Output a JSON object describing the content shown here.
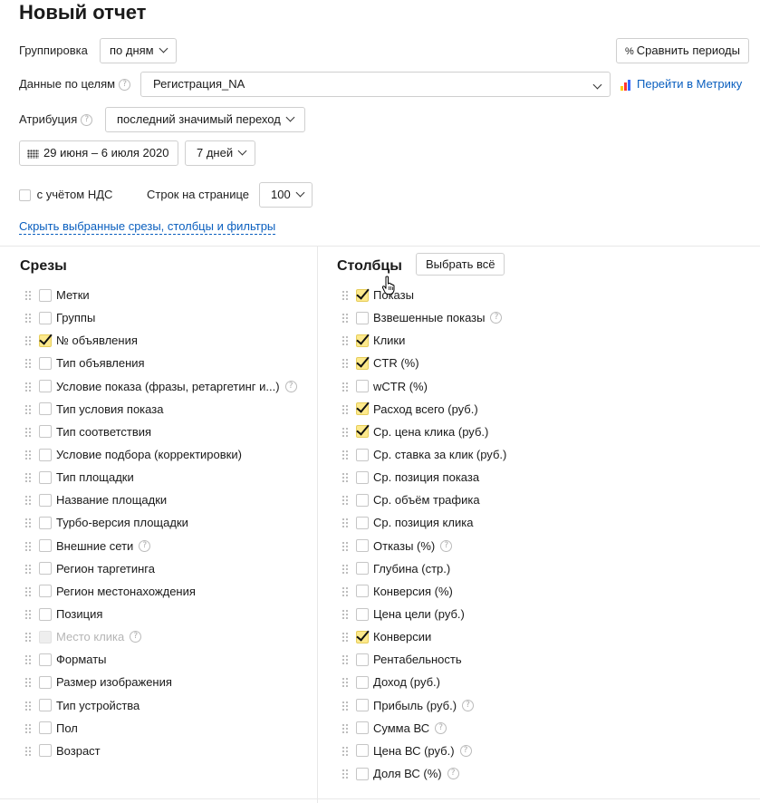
{
  "header": {
    "title": "Новый отчет"
  },
  "controls": {
    "grouping_label": "Группировка",
    "grouping_value": "по дням",
    "compare_label": "Сравнить периоды",
    "compare_icon": "%",
    "goals_label": "Данные по целям",
    "goals_value": "Регистрация_NA",
    "metrika_link": "Перейти в Метрику",
    "attribution_label": "Атрибуция",
    "attribution_value": "последний значимый переход",
    "date_range": "29 июня – 6 июля 2020",
    "period_value": "7 дней",
    "vat_label": "с учётом НДС",
    "rows_label": "Строк на странице",
    "rows_value": "100",
    "hide_link": "Скрыть выбранные срезы, столбцы и фильтры",
    "help_glyph": "?"
  },
  "slices": {
    "title": "Срезы",
    "items": [
      {
        "label": "Метки",
        "checked": false
      },
      {
        "label": "Группы",
        "checked": false
      },
      {
        "label": "№ объявления",
        "checked": true
      },
      {
        "label": "Тип объявления",
        "checked": false
      },
      {
        "label": "Условие показа (фразы, ретаргетинг и...)",
        "checked": false,
        "help": true
      },
      {
        "label": "Тип условия показа",
        "checked": false
      },
      {
        "label": "Тип соответствия",
        "checked": false
      },
      {
        "label": "Условие подбора (корректировки)",
        "checked": false
      },
      {
        "label": "Тип площадки",
        "checked": false
      },
      {
        "label": "Название площадки",
        "checked": false
      },
      {
        "label": "Турбо-версия площадки",
        "checked": false
      },
      {
        "label": "Внешние сети",
        "checked": false,
        "help": true
      },
      {
        "label": "Регион таргетинга",
        "checked": false
      },
      {
        "label": "Регион местонахождения",
        "checked": false
      },
      {
        "label": "Позиция",
        "checked": false
      },
      {
        "label": "Место клика",
        "checked": false,
        "disabled": true,
        "help": true
      },
      {
        "label": "Форматы",
        "checked": false
      },
      {
        "label": "Размер изображения",
        "checked": false
      },
      {
        "label": "Тип устройства",
        "checked": false
      },
      {
        "label": "Пол",
        "checked": false
      },
      {
        "label": "Возраст",
        "checked": false
      }
    ]
  },
  "columns": {
    "title": "Столбцы",
    "select_all": "Выбрать всё",
    "items": [
      {
        "label": "Показы",
        "checked": true
      },
      {
        "label": "Взвешенные показы",
        "checked": false,
        "help": true
      },
      {
        "label": "Клики",
        "checked": true
      },
      {
        "label": "CTR (%)",
        "checked": true
      },
      {
        "label": "wCTR (%)",
        "checked": false
      },
      {
        "label": "Расход всего (руб.)",
        "checked": true
      },
      {
        "label": "Ср. цена клика (руб.)",
        "checked": true
      },
      {
        "label": "Ср. ставка за клик (руб.)",
        "checked": false
      },
      {
        "label": "Ср. позиция показа",
        "checked": false
      },
      {
        "label": "Ср. объём трафика",
        "checked": false
      },
      {
        "label": "Ср. позиция клика",
        "checked": false
      },
      {
        "label": "Отказы (%)",
        "checked": false,
        "help": true
      },
      {
        "label": "Глубина (стр.)",
        "checked": false
      },
      {
        "label": "Конверсия (%)",
        "checked": false
      },
      {
        "label": "Цена цели (руб.)",
        "checked": false
      },
      {
        "label": "Конверсии",
        "checked": true
      },
      {
        "label": "Рентабельность",
        "checked": false
      },
      {
        "label": "Доход (руб.)",
        "checked": false
      },
      {
        "label": "Прибыль (руб.)",
        "checked": false,
        "help": true
      },
      {
        "label": "Сумма ВС",
        "checked": false,
        "help": true
      },
      {
        "label": "Цена ВС (руб.)",
        "checked": false,
        "help": true
      },
      {
        "label": "Доля ВС (%)",
        "checked": false,
        "help": true
      }
    ]
  },
  "colors": {
    "link": "#0a5fbf",
    "check_bg": "#fde98c",
    "metrika": [
      "#ffcc00",
      "#ff3333",
      "#3366ff"
    ]
  }
}
